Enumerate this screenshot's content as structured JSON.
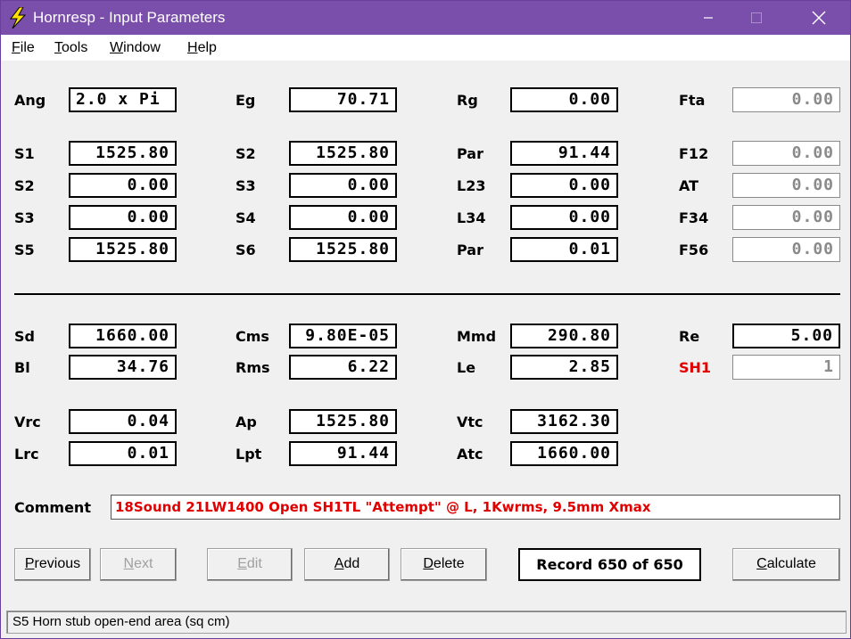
{
  "window": {
    "title": "Hornresp - Input Parameters",
    "accent": "#7a4fab"
  },
  "menu": [
    {
      "label_ul": "F",
      "label_rest": "ile"
    },
    {
      "label_ul": "T",
      "label_rest": "ools"
    },
    {
      "label_ul": "W",
      "label_rest": "indow"
    },
    {
      "label_ul": "H",
      "label_rest": "elp"
    }
  ],
  "params": {
    "ang": {
      "label": "Ang",
      "value": "2.0 x Pi"
    },
    "eg": {
      "label": "Eg",
      "value": "70.71"
    },
    "rg": {
      "label": "Rg",
      "value": "0.00"
    },
    "fta": {
      "label": "Fta",
      "value": "0.00"
    },
    "s1": {
      "label": "S1",
      "value": "1525.80"
    },
    "s2a": {
      "label": "S2",
      "value": "1525.80"
    },
    "par1": {
      "label": "Par",
      "value": "91.44"
    },
    "f12": {
      "label": "F12",
      "value": "0.00"
    },
    "s2b": {
      "label": "S2",
      "value": "0.00"
    },
    "s3a": {
      "label": "S3",
      "value": "0.00"
    },
    "l23": {
      "label": "L23",
      "value": "0.00"
    },
    "at": {
      "label": "AT",
      "value": "0.00"
    },
    "s3b": {
      "label": "S3",
      "value": "0.00"
    },
    "s4": {
      "label": "S4",
      "value": "0.00"
    },
    "l34": {
      "label": "L34",
      "value": "0.00"
    },
    "f34": {
      "label": "F34",
      "value": "0.00"
    },
    "s5": {
      "label": "S5",
      "value": "1525.80"
    },
    "s6": {
      "label": "S6",
      "value": "1525.80"
    },
    "par2": {
      "label": "Par",
      "value": "0.01"
    },
    "f56": {
      "label": "F56",
      "value": "0.00"
    },
    "sd": {
      "label": "Sd",
      "value": "1660.00"
    },
    "cms": {
      "label": "Cms",
      "value": "9.80E-05"
    },
    "mmd": {
      "label": "Mmd",
      "value": "290.80"
    },
    "re": {
      "label": "Re",
      "value": "5.00"
    },
    "bl": {
      "label": "Bl",
      "value": "34.76"
    },
    "rms": {
      "label": "Rms",
      "value": "6.22"
    },
    "le": {
      "label": "Le",
      "value": "2.85"
    },
    "sh1": {
      "label": "SH1",
      "value": "1"
    },
    "vrc": {
      "label": "Vrc",
      "value": "0.04"
    },
    "ap": {
      "label": "Ap",
      "value": "1525.80"
    },
    "vtc": {
      "label": "Vtc",
      "value": "3162.30"
    },
    "lrc": {
      "label": "Lrc",
      "value": "0.01"
    },
    "lpt": {
      "label": "Lpt",
      "value": "91.44"
    },
    "atc": {
      "label": "Atc",
      "value": "1660.00"
    }
  },
  "comment": {
    "label": "Comment",
    "value": "18Sound 21LW1400 Open SH1TL \"Attempt\" @ L, 1Kwrms, 9.5mm Xmax",
    "color": "#e00000"
  },
  "buttons": {
    "previous": {
      "ul": "P",
      "rest": "revious"
    },
    "next": {
      "ul": "N",
      "rest": "ext"
    },
    "edit": {
      "ul": "E",
      "rest": "dit"
    },
    "add": {
      "ul": "A",
      "rest": "dd"
    },
    "delete": {
      "ul": "D",
      "rest": "elete"
    },
    "calculate": {
      "ul": "C",
      "rest": "alculate"
    }
  },
  "record": "Record 650 of 650",
  "status": "S5   Horn stub open-end area  (sq cm)"
}
